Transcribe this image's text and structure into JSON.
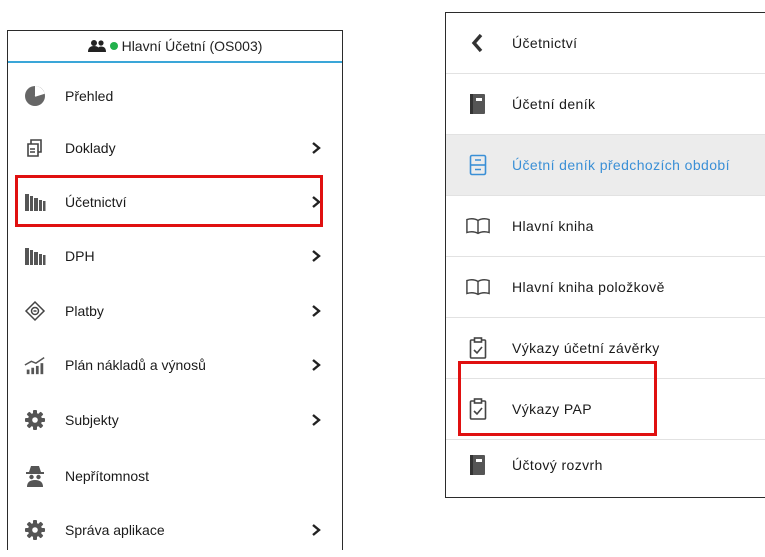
{
  "left_menu": {
    "header": "Hlavní Účetní (OS003)",
    "items": [
      {
        "label": "Přehled",
        "icon": "pie-chart-icon",
        "chevron": false
      },
      {
        "label": "Doklady",
        "icon": "documents-icon",
        "chevron": true
      },
      {
        "label": "Účetnictví",
        "icon": "books-icon",
        "chevron": true
      },
      {
        "label": "DPH",
        "icon": "books-icon",
        "chevron": true
      },
      {
        "label": "Platby",
        "icon": "money-icon",
        "chevron": true
      },
      {
        "label": "Plán nákladů a výnosů",
        "icon": "bar-growth-icon",
        "chevron": true
      },
      {
        "label": "Subjekty",
        "icon": "gear-icon",
        "chevron": true
      },
      {
        "label": "Nepřítomnost",
        "icon": "spy-icon",
        "chevron": false
      },
      {
        "label": "Správa aplikace",
        "icon": "gear-icon",
        "chevron": true
      }
    ]
  },
  "right_menu": {
    "back_label": "Účetnictví",
    "items": [
      {
        "label": "Účetní deník",
        "icon": "ledger-book-icon"
      },
      {
        "label": "Účetní deník předchozích období",
        "icon": "archive-cabinet-icon"
      },
      {
        "label": "Hlavní kniha",
        "icon": "open-book-icon"
      },
      {
        "label": "Hlavní kniha položkově",
        "icon": "open-book-icon"
      },
      {
        "label": "Výkazy účetní závěrky",
        "icon": "clipboard-check-icon"
      },
      {
        "label": "Výkazy PAP",
        "icon": "clipboard-check-icon"
      },
      {
        "label": "Účtový rozvrh",
        "icon": "ledger-book-icon"
      }
    ]
  },
  "colors": {
    "accent_blue": "#3aa6d8",
    "highlight_text": "#3a8fd6",
    "highlight_bg": "#ececec",
    "online_dot": "#22b14c",
    "red_annotation": "#e01010"
  }
}
